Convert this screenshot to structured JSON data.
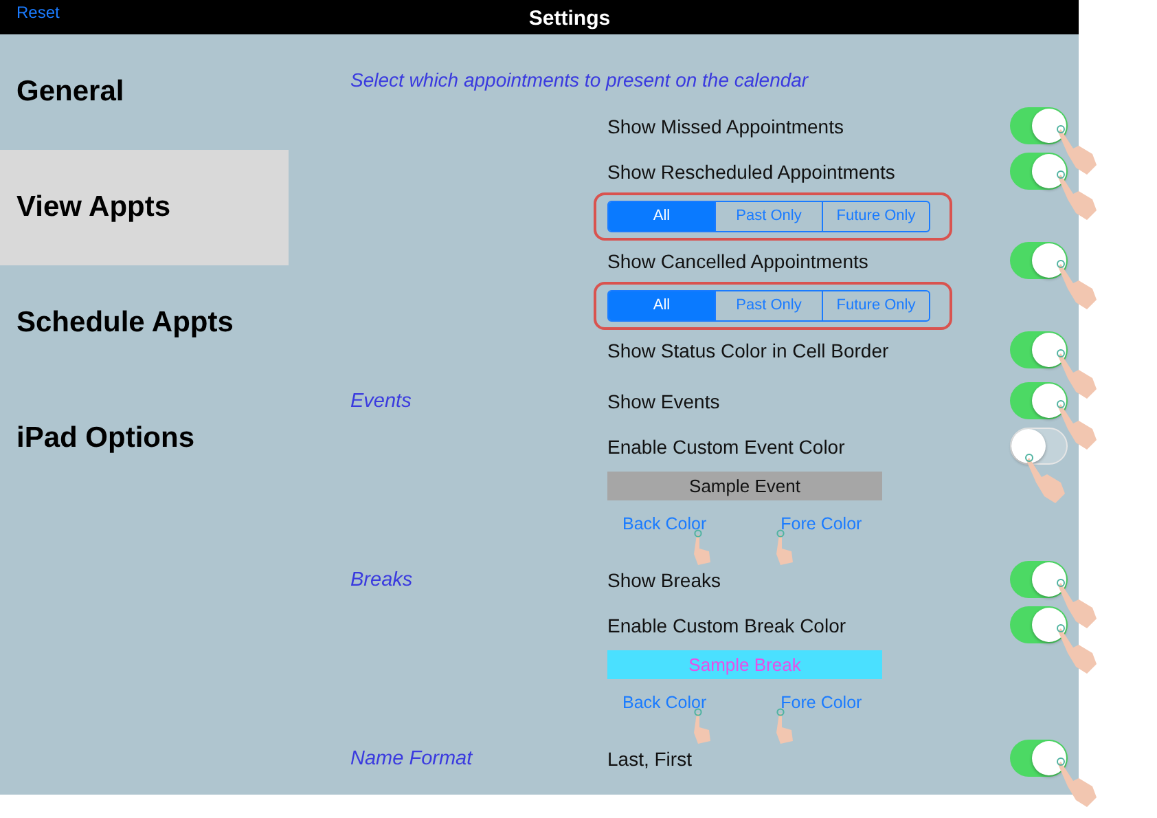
{
  "top_bar": {
    "reset": "Reset",
    "title": "Settings"
  },
  "sidebar": {
    "items": [
      {
        "label": "General",
        "selected": false
      },
      {
        "label": "View Appts",
        "selected": true
      },
      {
        "label": "Schedule Appts",
        "selected": false
      },
      {
        "label": "iPad Options",
        "selected": false
      }
    ]
  },
  "intro": "Select which appointments to present on the calendar",
  "sections": [
    {
      "items": [
        {
          "kind": "toggle",
          "label": "Show Missed Appointments",
          "on": true
        },
        {
          "kind": "toggle",
          "label": "Show Rescheduled Appointments",
          "on": true
        },
        {
          "kind": "segmented",
          "segments": [
            {
              "label": "All",
              "selected": true
            },
            {
              "label": "Past Only",
              "selected": false
            },
            {
              "label": "Future Only",
              "selected": false
            }
          ]
        },
        {
          "kind": "toggle",
          "label": "Show Cancelled Appointments",
          "on": true
        },
        {
          "kind": "segmented",
          "segments": [
            {
              "label": "All",
              "selected": true
            },
            {
              "label": "Past Only",
              "selected": false
            },
            {
              "label": "Future Only",
              "selected": false
            }
          ]
        },
        {
          "kind": "toggle",
          "label": "Show Status Color in Cell Border",
          "on": true
        }
      ]
    },
    {
      "label": "Events",
      "items": [
        {
          "kind": "toggle",
          "label": "Show Events",
          "on": true
        },
        {
          "kind": "toggle",
          "label": "Enable Custom Event Color",
          "on": false
        },
        {
          "kind": "sample",
          "color": "#a6a6a6",
          "caption": {
            "text": "Sample Event",
            "color": "#111111"
          }
        },
        {
          "kind": "links",
          "links": [
            "Back Color",
            "Fore Color"
          ]
        }
      ]
    },
    {
      "label": "Breaks",
      "items": [
        {
          "kind": "toggle",
          "label": "Show Breaks",
          "on": true
        },
        {
          "kind": "toggle",
          "label": "Enable Custom Break Color",
          "on": true
        },
        {
          "kind": "sample",
          "color": "#4ae0ff",
          "caption": {
            "text": "Sample Break",
            "color": "#e84fe8"
          }
        },
        {
          "kind": "links",
          "links": [
            "Back Color",
            "Fore Color"
          ]
        }
      ]
    },
    {
      "label": "Name Format",
      "items": [
        {
          "kind": "toggle",
          "label": "Last, First",
          "on": true
        }
      ]
    }
  ]
}
